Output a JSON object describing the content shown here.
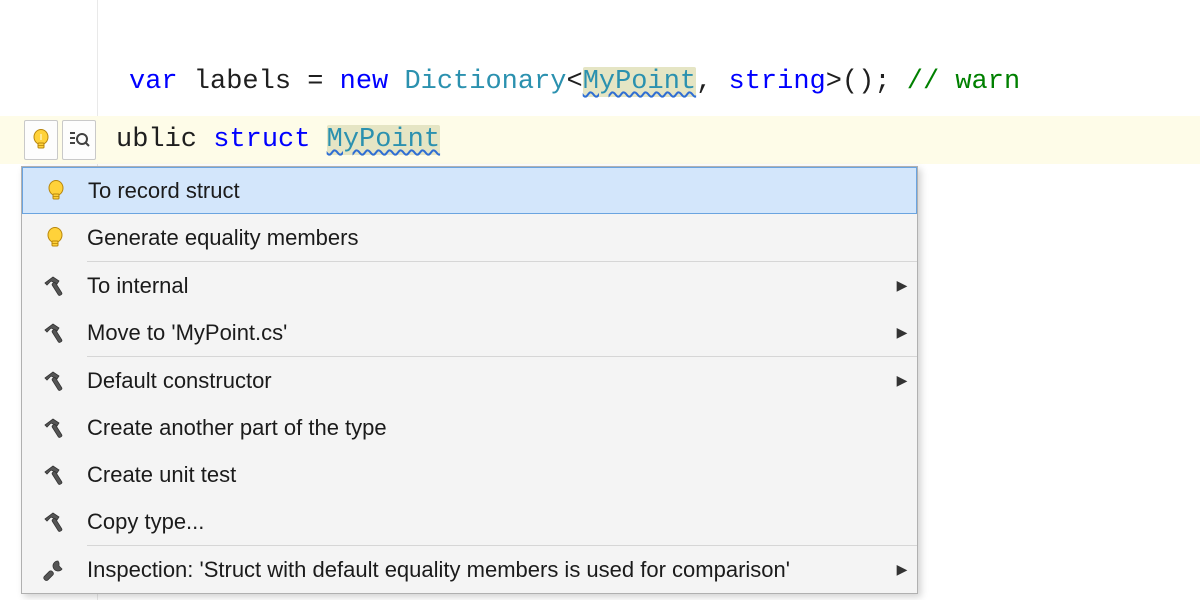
{
  "code": {
    "line1": {
      "kw_var": "var",
      "ident_labels": " labels ",
      "eq": "=",
      "kw_new": " new",
      "type_dict": " Dictionary",
      "lt": "<",
      "type_mypoint": "MyPoint",
      "comma": ",",
      "kw_string": " string",
      "gt_paren_semi": ">();",
      "comment": " // warn"
    },
    "current": {
      "prefix": "ublic ",
      "kw_struct": "struct",
      "space": " ",
      "type_mypoint": "MyPoint"
    }
  },
  "menu": {
    "items": [
      {
        "icon": "bulb",
        "label": "To record struct",
        "selected": true,
        "submenu": false
      },
      {
        "icon": "bulb",
        "label": "Generate equality members",
        "selected": false,
        "submenu": false
      },
      {
        "sep": true
      },
      {
        "icon": "hammer",
        "label": "To internal",
        "selected": false,
        "submenu": true
      },
      {
        "icon": "hammer",
        "label": "Move to 'MyPoint.cs'",
        "selected": false,
        "submenu": true
      },
      {
        "sep": true
      },
      {
        "icon": "hammer",
        "label": "Default constructor",
        "selected": false,
        "submenu": true
      },
      {
        "icon": "hammer",
        "label": "Create another part of the type",
        "selected": false,
        "submenu": false
      },
      {
        "icon": "hammer",
        "label": "Create unit test",
        "selected": false,
        "submenu": false
      },
      {
        "icon": "hammer",
        "label": "Copy type...",
        "selected": false,
        "submenu": false
      },
      {
        "sep": true
      },
      {
        "icon": "wrench",
        "label": "Inspection: 'Struct with default equality members is used for comparison'",
        "selected": false,
        "submenu": true
      }
    ]
  }
}
